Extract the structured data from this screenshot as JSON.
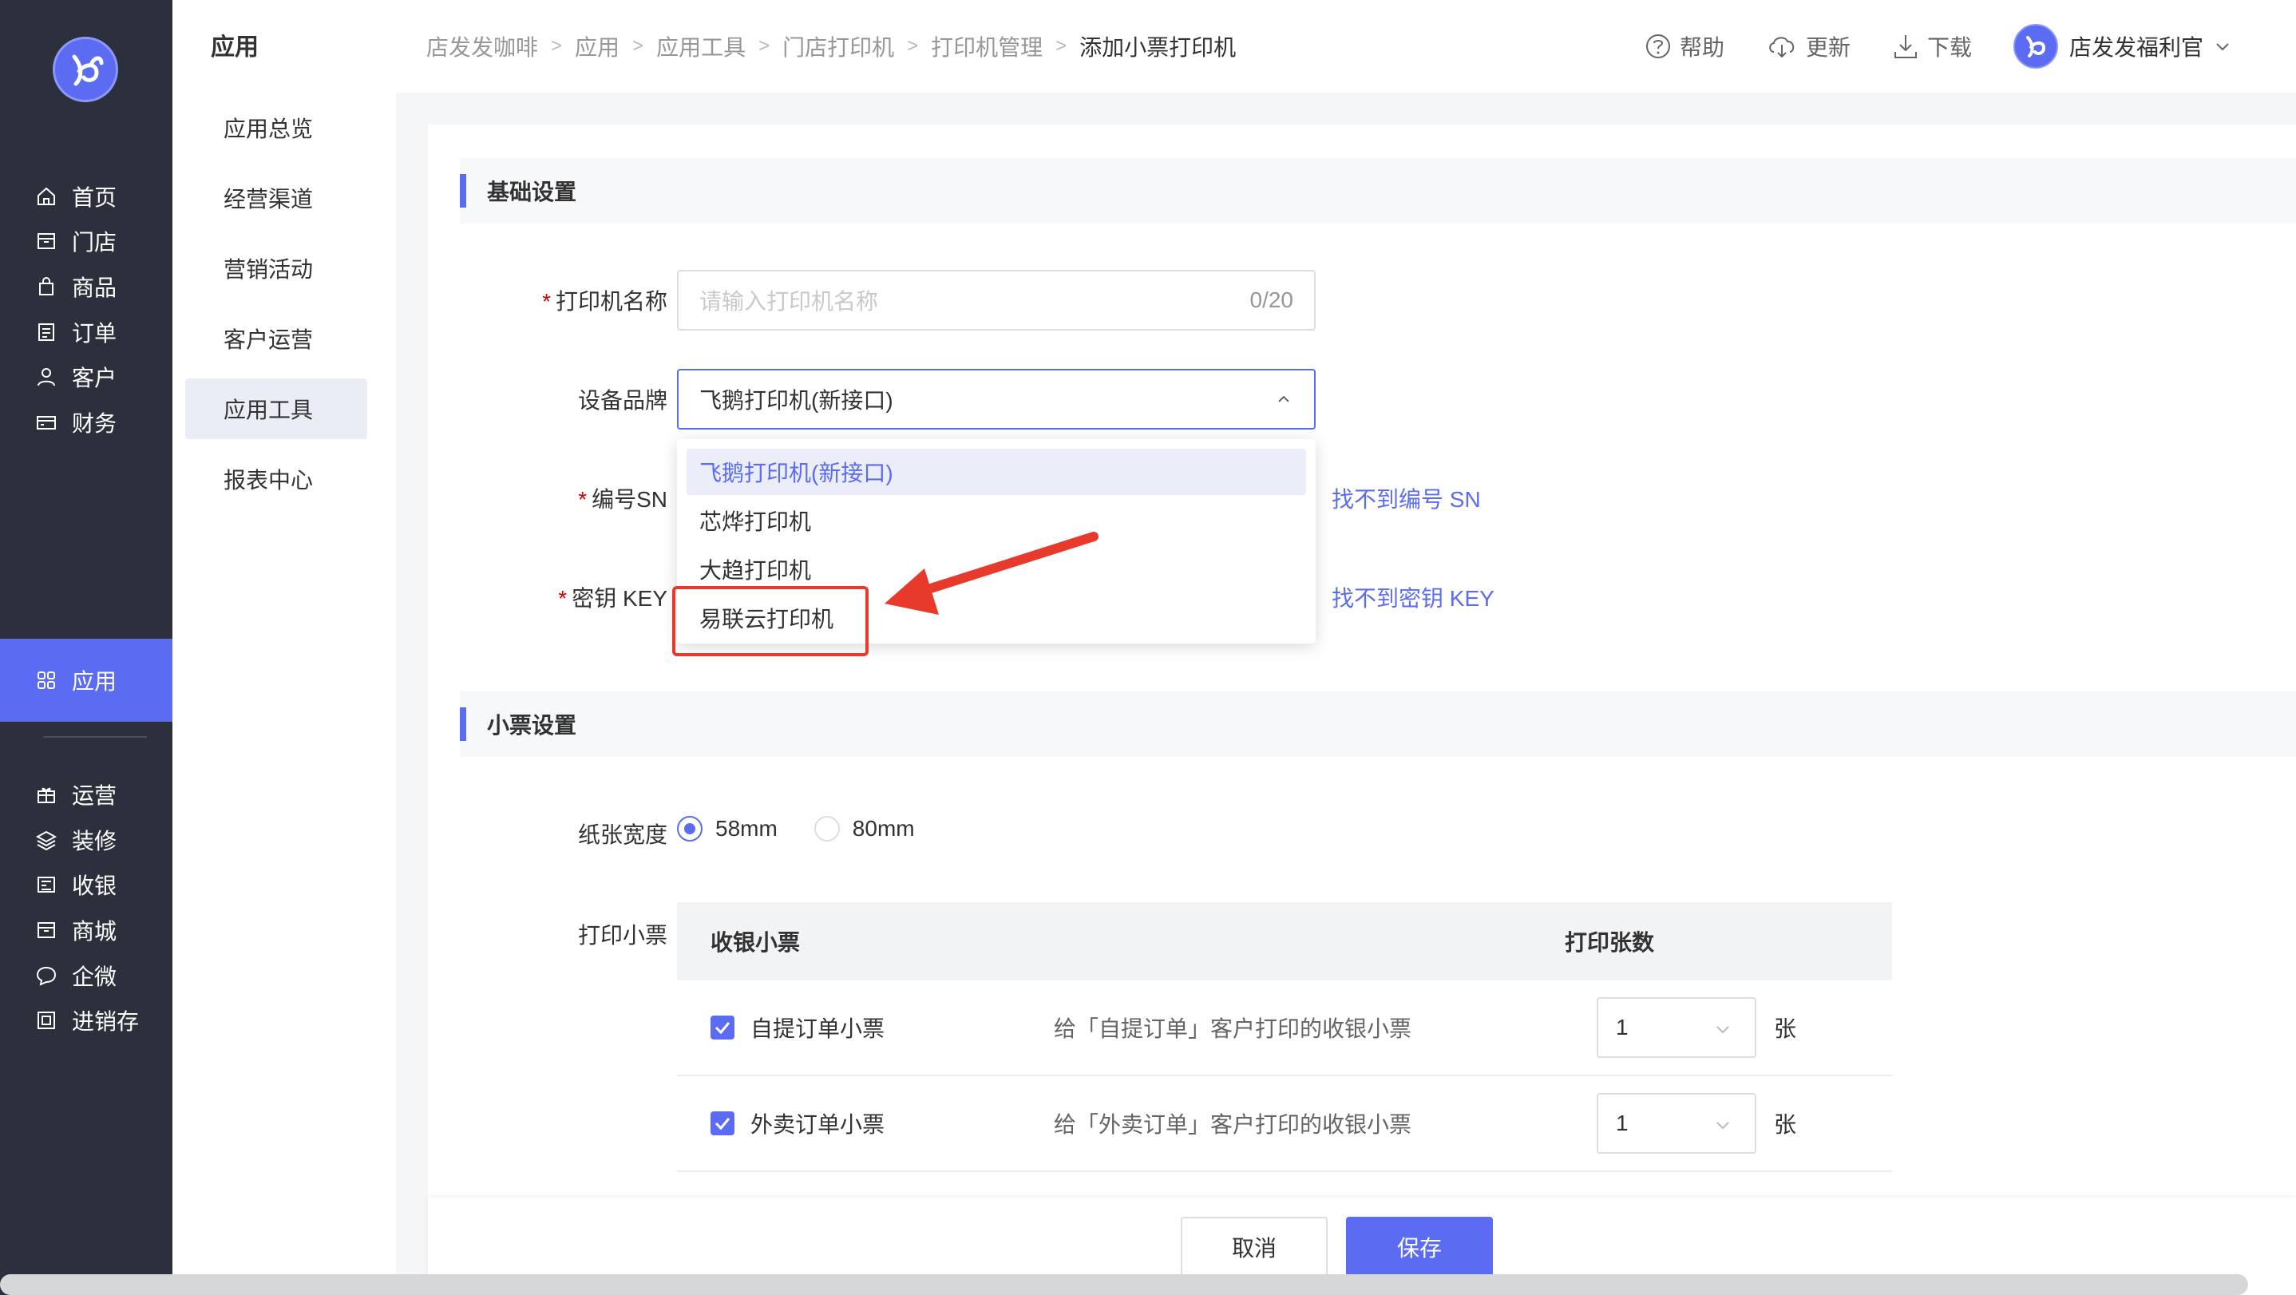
{
  "nav": {
    "items": [
      {
        "label": "首页",
        "icon": "home-icon"
      },
      {
        "label": "门店",
        "icon": "store-icon"
      },
      {
        "label": "商品",
        "icon": "bag-icon"
      },
      {
        "label": "订单",
        "icon": "order-icon"
      },
      {
        "label": "客户",
        "icon": "user-icon"
      },
      {
        "label": "财务",
        "icon": "wallet-icon"
      },
      {
        "label": "应用",
        "icon": "apps-icon",
        "active": true
      },
      {
        "label": "运营",
        "icon": "gift-icon"
      },
      {
        "label": "装修",
        "icon": "layers-icon"
      },
      {
        "label": "收银",
        "icon": "cashier-icon"
      },
      {
        "label": "商城",
        "icon": "mall-icon"
      },
      {
        "label": "企微",
        "icon": "chat-icon"
      },
      {
        "label": "进销存",
        "icon": "inventory-icon"
      }
    ]
  },
  "subnav": {
    "title": "应用",
    "items": [
      "应用总览",
      "经营渠道",
      "营销活动",
      "客户运营",
      "应用工具",
      "报表中心"
    ],
    "active_index": 4
  },
  "breadcrumb": [
    "店发发咖啡",
    "应用",
    "应用工具",
    "门店打印机",
    "打印机管理",
    "添加小票打印机"
  ],
  "top_actions": {
    "help": "帮助",
    "update": "更新",
    "download": "下载",
    "user": "店发发福利官"
  },
  "basic": {
    "title": "基础设置",
    "printer_name_label": "打印机名称",
    "printer_name_placeholder": "请输入打印机名称",
    "printer_name_count": "0/20",
    "brand_label": "设备品牌",
    "brand_value": "飞鹅打印机(新接口)",
    "brand_options": [
      "飞鹅打印机(新接口)",
      "芯烨打印机",
      "大趋打印机",
      "易联云打印机"
    ],
    "sn_label": "编号SN",
    "sn_link": "找不到编号 SN",
    "key_label": "密钥 KEY",
    "key_link": "找不到密钥 KEY"
  },
  "receipt": {
    "title": "小票设置",
    "paper_label": "纸张宽度",
    "paper_options": [
      "58mm",
      "80mm"
    ],
    "paper_selected": "58mm",
    "print_label": "打印小票",
    "table_headers": [
      "收银小票",
      "打印张数"
    ],
    "rows": [
      {
        "name": "自提订单小票",
        "desc": "给「自提订单」客户打印的收银小票",
        "count": "1",
        "unit": "张"
      },
      {
        "name": "外卖订单小票",
        "desc": "给「外卖订单」客户打印的收银小票",
        "count": "1",
        "unit": "张"
      }
    ]
  },
  "footer": {
    "cancel": "取消",
    "save": "保存"
  },
  "colors": {
    "accent": "#5b6cf2",
    "sidebar": "#2c303c",
    "highlight": "#e83a2c"
  }
}
